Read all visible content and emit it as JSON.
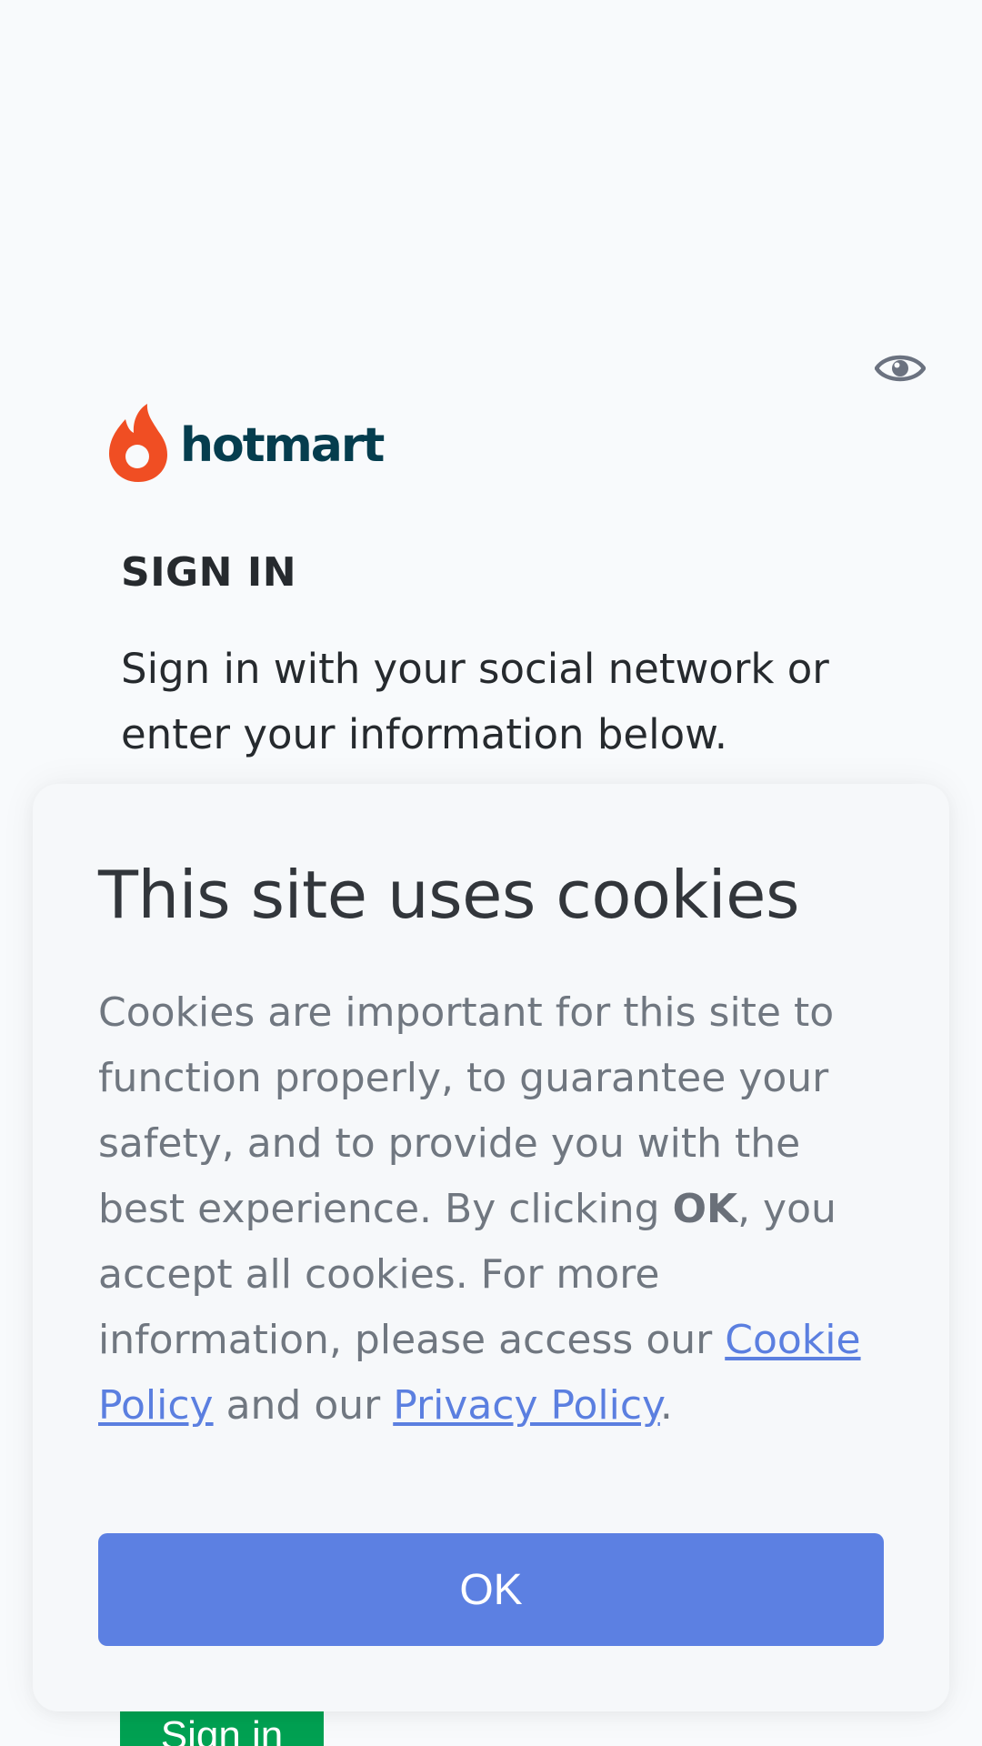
{
  "brand": {
    "name": "hotmart",
    "logo_icon": "hotmart-flame-icon",
    "primary_color": "#053d4e",
    "flame_color": "#f04e23"
  },
  "header": {
    "eye_icon": "eye-icon"
  },
  "signin": {
    "title": "SIGN IN",
    "description": "Sign in with your social network or enter your information below.",
    "button_label": "Sign in",
    "button_color": "#00a152"
  },
  "cookie_banner": {
    "title": "This site uses cookies",
    "text_part1": "Cookies are important for this site to function properly, to guarantee your safety, and to provide you with the best experience. By clicking ",
    "text_bold": "OK",
    "text_part2": ", you accept all cookies. For more information, please access our ",
    "cookie_policy_link": "Cookie Policy",
    "text_part3": " and our ",
    "privacy_policy_link": "Privacy Policy",
    "text_part4": ".",
    "ok_label": "OK",
    "ok_color": "#5c80e2"
  }
}
